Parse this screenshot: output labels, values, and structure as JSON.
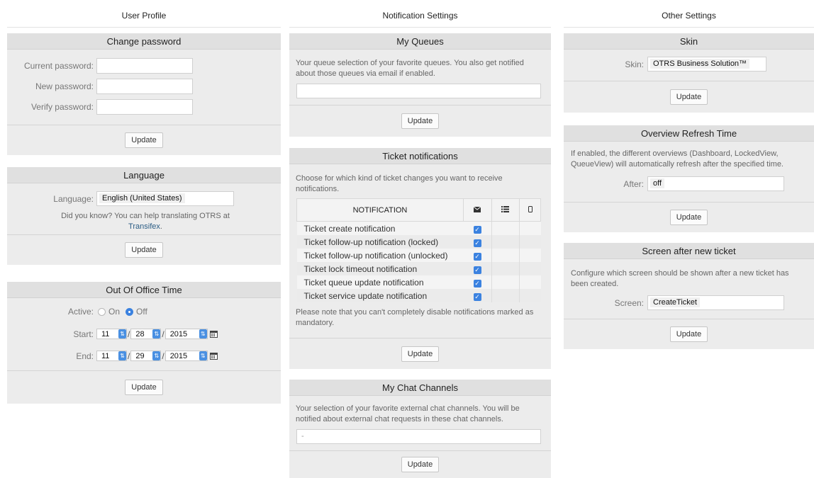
{
  "columns": {
    "user_profile": "User Profile",
    "notification_settings": "Notification Settings",
    "other_settings": "Other Settings"
  },
  "update_label": "Update",
  "change_password": {
    "title": "Change password",
    "current_label": "Current password:",
    "new_label": "New password:",
    "verify_label": "Verify password:"
  },
  "language": {
    "title": "Language",
    "label": "Language:",
    "value": "English (United States)",
    "hint": "Did you know? You can help translating OTRS at",
    "link": "Transifex",
    "link_suffix": "."
  },
  "out_of_office": {
    "title": "Out Of Office Time",
    "active_label": "Active:",
    "on_label": "On",
    "off_label": "Off",
    "active_value": "Off",
    "start_label": "Start:",
    "end_label": "End:",
    "start": {
      "month": "11",
      "day": "28",
      "year": "2015"
    },
    "end": {
      "month": "11",
      "day": "29",
      "year": "2015"
    }
  },
  "my_queues": {
    "title": "My Queues",
    "description": "Your queue selection of your favorite queues. You also get notified about those queues via email if enabled.",
    "value": ""
  },
  "ticket_notifications": {
    "title": "Ticket notifications",
    "description": "Choose for which kind of ticket changes you want to receive notifications.",
    "column_header": "NOTIFICATION",
    "icons": [
      "envelope-icon",
      "list-icon",
      "mobile-icon"
    ],
    "rows": [
      "Ticket create notification",
      "Ticket follow-up notification (locked)",
      "Ticket follow-up notification (unlocked)",
      "Ticket lock timeout notification",
      "Ticket queue update notification",
      "Ticket service update notification"
    ],
    "note": "Please note that you can't completely disable notifications marked as mandatory."
  },
  "chat_channels": {
    "title": "My Chat Channels",
    "description": "Your selection of your favorite external chat channels. You will be notified about external chat requests in these chat channels.",
    "value": "-"
  },
  "skin": {
    "title": "Skin",
    "label": "Skin:",
    "value": "OTRS Business Solution™"
  },
  "refresh": {
    "title": "Overview Refresh Time",
    "description": "If enabled, the different overviews (Dashboard, LockedView, QueueView) will automatically refresh after the specified time.",
    "label": "After:",
    "value": "off"
  },
  "screen_after": {
    "title": "Screen after new ticket",
    "description": "Configure which screen should be shown after a new ticket has been created.",
    "label": "Screen:",
    "value": "CreateTicket"
  },
  "colors": {
    "accent": "#3b82e0",
    "link": "#2b5d85",
    "panel": "#ececec"
  }
}
